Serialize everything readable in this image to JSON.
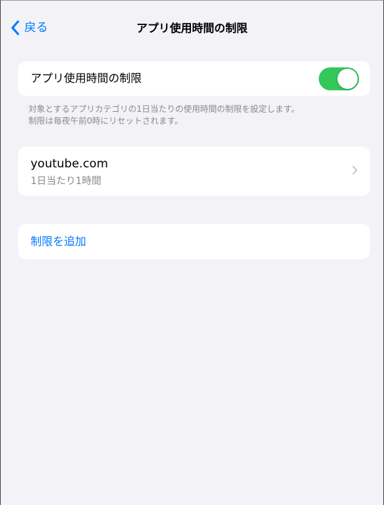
{
  "nav": {
    "back_label": "戻る",
    "title": "アプリ使用時間の制限"
  },
  "toggle_group": {
    "label": "アプリ使用時間の制限",
    "enabled": true
  },
  "footer_note": {
    "line1": "対象とするアプリカテゴリの1日当たりの使用時間の制限を設定します。",
    "line2": "制限は毎夜午前0時にリセットされます。"
  },
  "limits": [
    {
      "title": "youtube.com",
      "subtitle": "1日当たり1時間"
    }
  ],
  "add_limit_label": "制限を追加",
  "icons": {
    "back": "chevron-left-icon",
    "disclosure": "chevron-right-icon"
  },
  "colors": {
    "accent": "#007aff",
    "switch_on": "#34c759",
    "background": "#f2f2f7",
    "secondary_text": "#8a8a8e"
  }
}
